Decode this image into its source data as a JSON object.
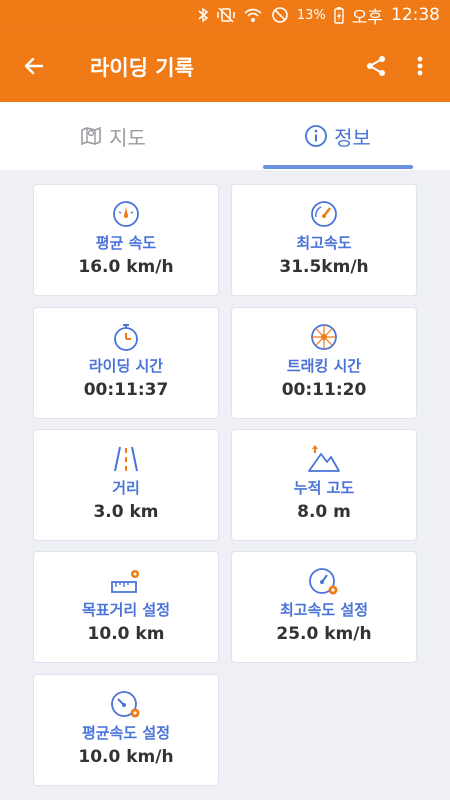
{
  "status_bar": {
    "battery": "13%",
    "ampm": "오후",
    "time": "12:38"
  },
  "app_bar": {
    "title": "라이딩 기록"
  },
  "tabs": [
    {
      "label": "지도",
      "icon": "map-icon",
      "selected": false
    },
    {
      "label": "정보",
      "icon": "info-icon",
      "selected": true
    }
  ],
  "stats": [
    {
      "label": "평균 속도",
      "value": "16.0 km/h",
      "icon": "speedometer-icon"
    },
    {
      "label": "최고속도",
      "value": "31.5km/h",
      "icon": "gauge-icon"
    },
    {
      "label": "라이딩 시간",
      "value": "00:11:37",
      "icon": "stopwatch-icon"
    },
    {
      "label": "트래킹 시간",
      "value": "00:11:20",
      "icon": "wheel-icon"
    },
    {
      "label": "거리",
      "value": "3.0 km",
      "icon": "road-icon"
    },
    {
      "label": "누적 고도",
      "value": "8.0 m",
      "icon": "mountain-icon"
    },
    {
      "label": "목표거리 설정",
      "value": "10.0 km",
      "icon": "ruler-gear-icon"
    },
    {
      "label": "최고속도 설정",
      "value": "25.0 km/h",
      "icon": "gauge-gear-icon"
    },
    {
      "label": "평균속도 설정",
      "value": "10.0 km/h",
      "icon": "speedometer-gear-icon"
    }
  ],
  "colors": {
    "accent": "#f07a16",
    "primary_text": "#4a74d8",
    "background": "#eef0f6"
  }
}
